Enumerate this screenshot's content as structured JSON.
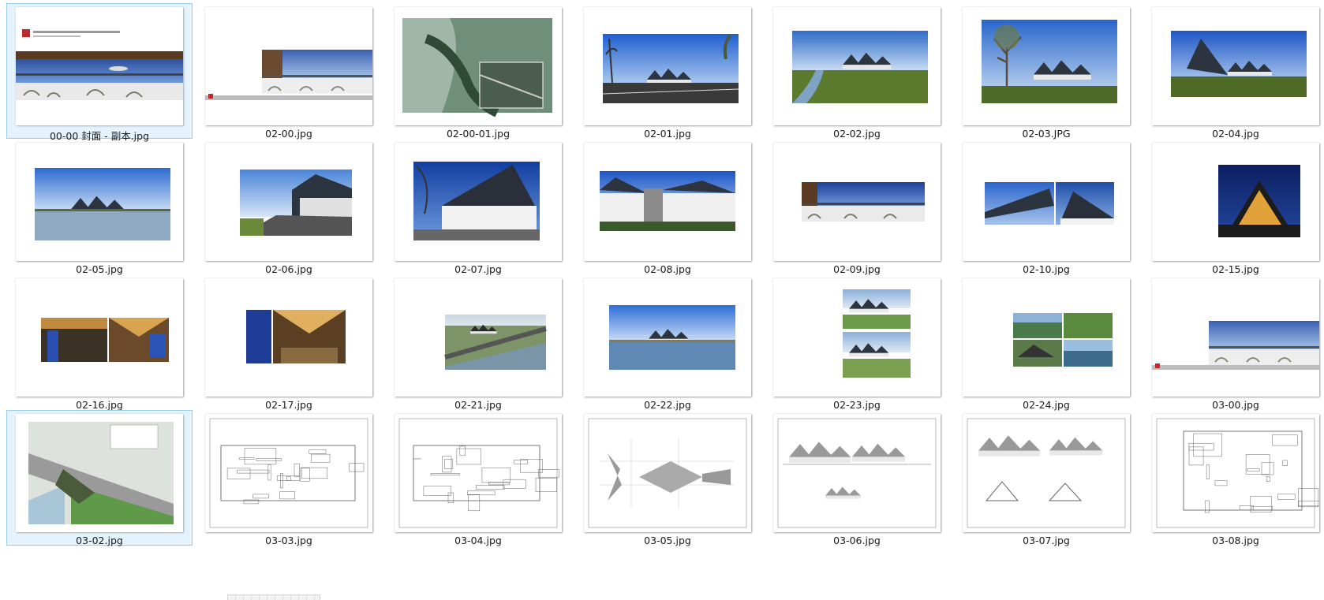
{
  "files": [
    {
      "name": "00-00 封面 - 副本.jpg",
      "kind": "cover",
      "selected": true
    },
    {
      "name": "02-00.jpg",
      "kind": "cover-right"
    },
    {
      "name": "02-00-01.jpg",
      "kind": "aerial"
    },
    {
      "name": "02-01.jpg",
      "kind": "photo-road"
    },
    {
      "name": "02-02.jpg",
      "kind": "photo-river"
    },
    {
      "name": "02-03.JPG",
      "kind": "photo-tree"
    },
    {
      "name": "02-04.jpg",
      "kind": "photo-grass"
    },
    {
      "name": "02-05.jpg",
      "kind": "photo-lake"
    },
    {
      "name": "02-06.jpg",
      "kind": "photo-street"
    },
    {
      "name": "02-07.jpg",
      "kind": "photo-closeup"
    },
    {
      "name": "02-08.jpg",
      "kind": "photo-facade"
    },
    {
      "name": "02-09.jpg",
      "kind": "strip"
    },
    {
      "name": "02-10.jpg",
      "kind": "two-roofs"
    },
    {
      "name": "02-15.jpg",
      "kind": "night"
    },
    {
      "name": "02-16.jpg",
      "kind": "interior-two"
    },
    {
      "name": "02-17.jpg",
      "kind": "interior-big"
    },
    {
      "name": "02-21.jpg",
      "kind": "render-aerial"
    },
    {
      "name": "02-22.jpg",
      "kind": "render-lake"
    },
    {
      "name": "02-23.jpg",
      "kind": "render-two"
    },
    {
      "name": "02-24.jpg",
      "kind": "render-four"
    },
    {
      "name": "03-00.jpg",
      "kind": "cover-right-edge"
    },
    {
      "name": "03-02.jpg",
      "kind": "siteplan",
      "selected": true
    },
    {
      "name": "03-03.jpg",
      "kind": "plan-long"
    },
    {
      "name": "03-04.jpg",
      "kind": "plan-two"
    },
    {
      "name": "03-05.jpg",
      "kind": "roof-plan"
    },
    {
      "name": "03-06.jpg",
      "kind": "elevation"
    },
    {
      "name": "03-07.jpg",
      "kind": "sections"
    },
    {
      "name": "03-08.jpg",
      "kind": "floor-plan"
    }
  ],
  "cover_text": "苏地2011-B-38号地块（苏山国家湿地中心）",
  "colors": {
    "sky": "#2a63c9",
    "sky_light": "#8fb6e6",
    "roof": "#2c3440",
    "grass": "#5c7a2e",
    "water": "#7fa3c4",
    "accent": "#c0272d"
  }
}
